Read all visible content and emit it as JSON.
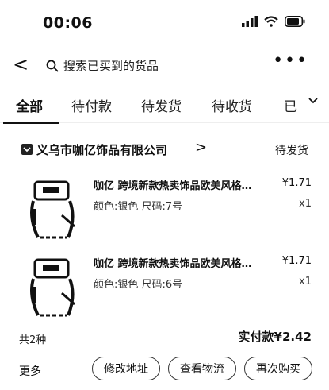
{
  "status_bar": {
    "time": "00:06"
  },
  "header": {
    "back_label": "<",
    "search_placeholder": "搜索已买到的货品",
    "more_label": "•••"
  },
  "tabs": [
    {
      "label": "全部"
    },
    {
      "label": "待付款"
    },
    {
      "label": "待发货"
    },
    {
      "label": "待收货"
    },
    {
      "label": "已"
    }
  ],
  "order": {
    "shop_name": "义乌市咖亿饰品有限公司",
    "shop_arrow": ">",
    "status": "待发货",
    "items": [
      {
        "title": "咖亿 跨境新款热卖饰品欧美风格创意",
        "spec": "颜色:银色 尺码:7号",
        "price": "¥1.71",
        "qty": "x1"
      },
      {
        "title": "咖亿 跨境新款热卖饰品欧美风格创意",
        "spec": "颜色:银色 尺码:6号",
        "price": "¥1.71",
        "qty": "x1"
      }
    ],
    "count_label": "共2种",
    "total_label": "实付款¥2.42"
  },
  "actions": {
    "more": "更多",
    "modify_address": "修改地址",
    "view_logistics": "查看物流",
    "buy_again": "再次购买"
  }
}
